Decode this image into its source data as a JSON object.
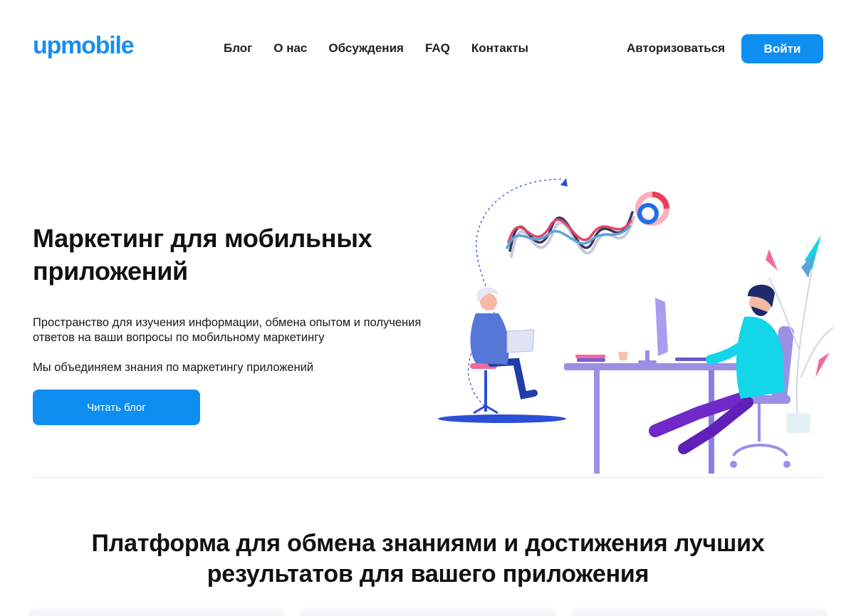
{
  "header": {
    "logo": "upmobile",
    "nav": [
      {
        "label": "Блог"
      },
      {
        "label": "О нас"
      },
      {
        "label": "Обсуждения"
      },
      {
        "label": "FAQ"
      },
      {
        "label": "Контакты"
      }
    ],
    "auth_label": "Авторизоваться",
    "login_label": "Войти"
  },
  "hero": {
    "title": "Маркетинг для мобильных приложений",
    "description": "Пространство для изучения информации, обмена опытом и получения ответов на ваши вопросы по мобильному маркетингу",
    "subtitle": "Мы объединяем знания по маркетингу приложений",
    "cta_label": "Читать блог"
  },
  "section": {
    "title": "Платформа для обмена знаниями и достижения лучших результатов для вашего приложения"
  },
  "colors": {
    "accent": "#0f8ef1",
    "text": "#1a1a1a",
    "illustration_purple": "#9b8fe6",
    "illustration_blue": "#2b4fd6",
    "illustration_cyan": "#13d6e8",
    "illustration_pink": "#f06a9a"
  },
  "icons": {
    "illustration": "analytics-team-illustration"
  }
}
